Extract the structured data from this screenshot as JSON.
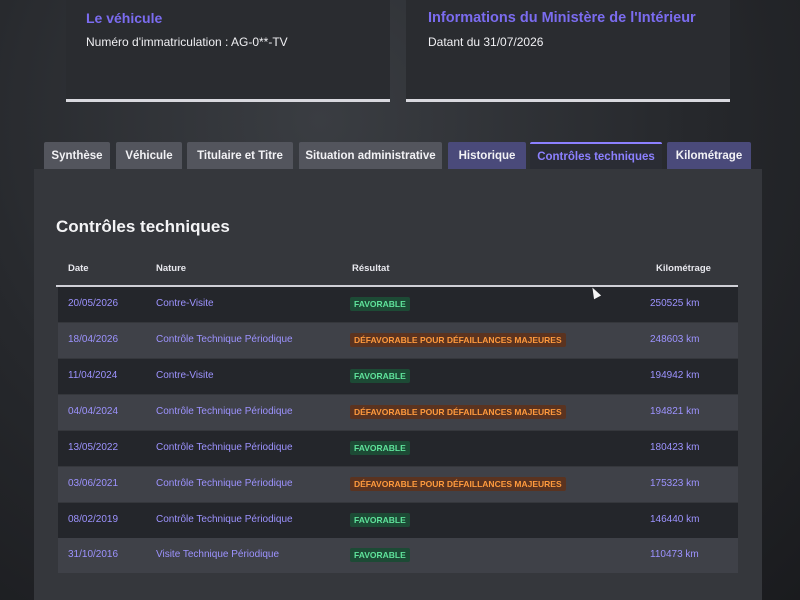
{
  "vehicle_card": {
    "title": "Le véhicule",
    "registration": "Numéro d'immatriculation : AG-0**-TV"
  },
  "ministry_card": {
    "title": "Informations du Ministère de l'Intérieur",
    "date": "Datant du 31/07/2026"
  },
  "tabs": [
    {
      "label": "Synthèse"
    },
    {
      "label": "Véhicule"
    },
    {
      "label": "Titulaire et Titre"
    },
    {
      "label": "Situation administrative"
    },
    {
      "label": "Historique"
    },
    {
      "label": "Contrôles techniques",
      "active": true
    },
    {
      "label": "Kilométrage"
    }
  ],
  "section": {
    "title": "Contrôles techniques",
    "columns": {
      "date": "Date",
      "nature": "Nature",
      "result": "Résultat",
      "km": "Kilométrage"
    },
    "rows": [
      {
        "date": "20/05/2026",
        "nature": "Contre-Visite",
        "result": "FAVORABLE",
        "km": "250525 km"
      },
      {
        "date": "18/04/2026",
        "nature": "Contrôle Technique Périodique",
        "result": "DÉFAVORABLE POUR DÉFAILLANCES MAJEURES",
        "km": "248603 km"
      },
      {
        "date": "11/04/2024",
        "nature": "Contre-Visite",
        "result": "FAVORABLE",
        "km": "194942 km"
      },
      {
        "date": "04/04/2024",
        "nature": "Contrôle Technique Périodique",
        "result": "DÉFAVORABLE POUR DÉFAILLANCES MAJEURES",
        "km": "194821 km"
      },
      {
        "date": "13/05/2022",
        "nature": "Contrôle Technique Périodique",
        "result": "FAVORABLE",
        "km": "180423 km"
      },
      {
        "date": "03/06/2021",
        "nature": "Contrôle Technique Périodique",
        "result": "DÉFAVORABLE POUR DÉFAILLANCES MAJEURES",
        "km": "175323 km"
      },
      {
        "date": "08/02/2019",
        "nature": "Contrôle Technique Périodique",
        "result": "FAVORABLE",
        "km": "146440 km"
      },
      {
        "date": "31/10/2016",
        "nature": "Visite Technique Périodique",
        "result": "FAVORABLE",
        "km": "110473 km"
      }
    ]
  },
  "colors": {
    "accent": "#8c80ff",
    "favorable": "#5fe39b",
    "defavorable": "#ff9a3d"
  },
  "icons": {
    "cursor": "mouse-pointer-icon"
  }
}
